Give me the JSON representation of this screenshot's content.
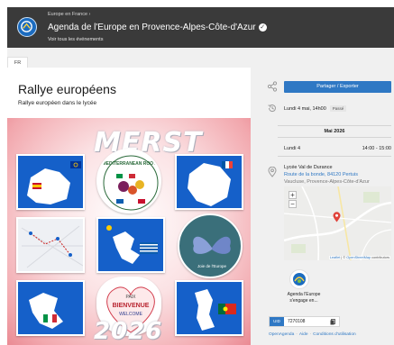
{
  "header": {
    "breadcrumb": "Europe en France ›",
    "title": "Agenda de l'Europe en Provence-Alpes-Côte-d'Azur",
    "subtitle": "Voir tous les événements"
  },
  "language_tab": "FR",
  "event": {
    "title": "Rallye européens",
    "description": "Rallye européen dans le lycée",
    "poster": {
      "top_word": "MERST",
      "bottom_word": "2026",
      "roots_text": "MEDITERRANEAN ROOTS",
      "europe_text": "PAIX",
      "cloud_words": [
        "BIENVENUE",
        "WELCOME",
        "PAIX"
      ],
      "circle_caption": "Joie de l'Europe"
    }
  },
  "sidebar": {
    "share_label": "Partager / Exporter",
    "date_text": "Lundi 4 mai, 14h00",
    "date_badge": "Passé",
    "schedule_month": "Mai 2026",
    "schedule_day": "Lundi 4",
    "schedule_time": "14:00 - 15:00",
    "venue_name": "Lycée Val de Durance",
    "venue_address": "Route de la bonde, 84120 Pertuis",
    "venue_region": "Vaucluse, Provence-Alpes-Côte-d'Azur",
    "map_zoom_in": "+",
    "map_zoom_out": "−",
    "map_attribution_leaflet": "Leaflet",
    "map_attribution_sep": " | © ",
    "map_attribution_osm": "OpenStreetMap",
    "map_attribution_suffix": " contributors",
    "organizer_name": "Agenda l'Europe s'engage en...",
    "uid_label": "UID",
    "uid_value": "7270108",
    "footer": {
      "openagenda": "OpenAgenda",
      "help": "Aide",
      "terms": "Conditions d'utilisation",
      "separator": "·"
    }
  },
  "icons": [
    "share-icon",
    "history-icon",
    "location-pin-icon",
    "verified-check-icon",
    "copy-icon"
  ],
  "colors": {
    "header_bg": "#3a3a3a",
    "accent": "#2f78c4",
    "poster_blue": "#1560c9",
    "poster_pink": "#ea8a93"
  }
}
